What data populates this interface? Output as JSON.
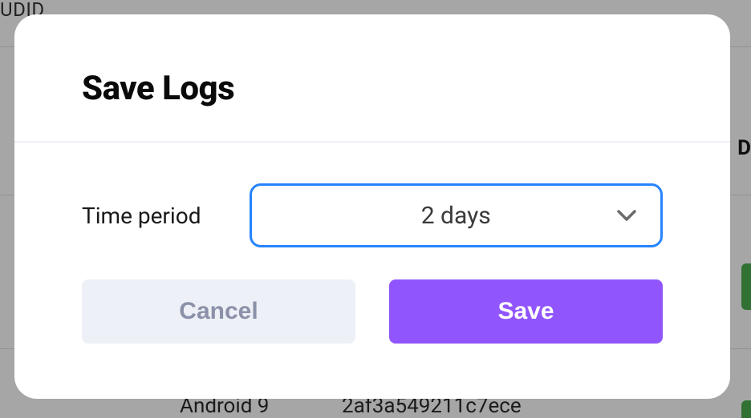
{
  "background": {
    "header_fragment": "UDID",
    "partial_letter": "D",
    "row_os": "Android 9",
    "row_udid": "2af3a549211c7ece"
  },
  "modal": {
    "title": "Save Logs",
    "time_period_label": "Time period",
    "time_period_value": "2 days",
    "cancel_label": "Cancel",
    "save_label": "Save"
  }
}
